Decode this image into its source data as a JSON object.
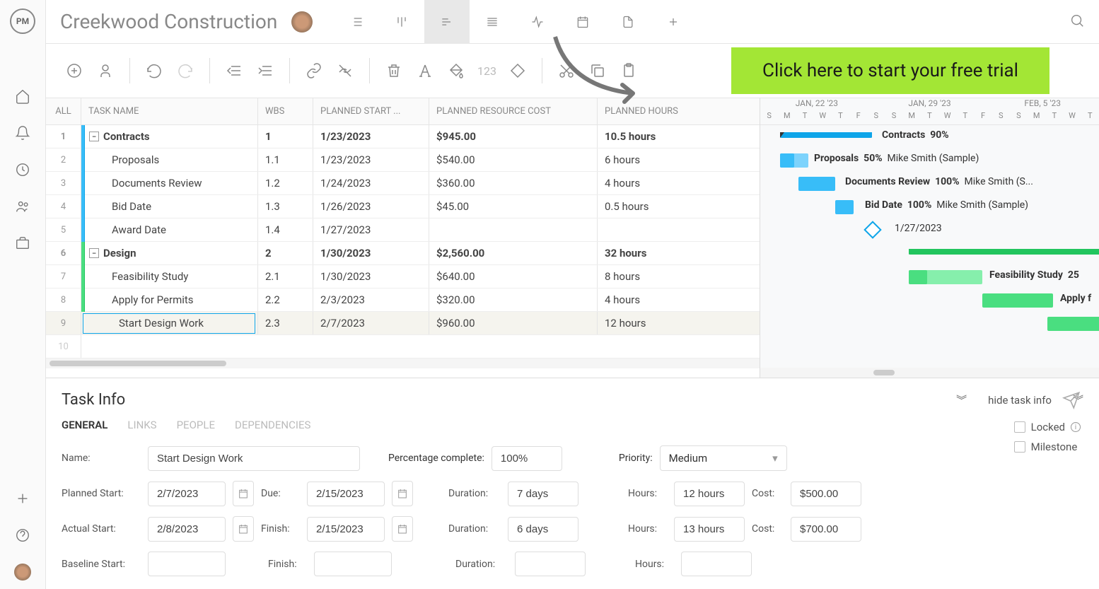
{
  "project": {
    "title": "Creekwood Construction"
  },
  "cta": {
    "text": "Click here to start your free trial"
  },
  "columns": {
    "all": "ALL",
    "task": "TASK NAME",
    "wbs": "WBS",
    "start": "PLANNED START ...",
    "cost": "PLANNED RESOURCE COST",
    "hours": "PLANNED HOURS"
  },
  "rows": [
    {
      "num": "1",
      "name": "Contracts",
      "wbs": "1",
      "start": "1/23/2023",
      "cost": "$945.00",
      "hours": "10.5 hours",
      "bold": true,
      "color": "blue",
      "expand": true
    },
    {
      "num": "2",
      "name": "Proposals",
      "wbs": "1.1",
      "start": "1/23/2023",
      "cost": "$540.00",
      "hours": "6 hours",
      "color": "blue",
      "indent": true
    },
    {
      "num": "3",
      "name": "Documents Review",
      "wbs": "1.2",
      "start": "1/24/2023",
      "cost": "$360.00",
      "hours": "4 hours",
      "color": "blue",
      "indent": true
    },
    {
      "num": "4",
      "name": "Bid Date",
      "wbs": "1.3",
      "start": "1/26/2023",
      "cost": "$45.00",
      "hours": "0.5 hours",
      "color": "blue",
      "indent": true
    },
    {
      "num": "5",
      "name": "Award Date",
      "wbs": "1.4",
      "start": "1/27/2023",
      "cost": "",
      "hours": "",
      "color": "blue",
      "indent": true
    },
    {
      "num": "6",
      "name": "Design",
      "wbs": "2",
      "start": "1/30/2023",
      "cost": "$2,560.00",
      "hours": "32 hours",
      "bold": true,
      "color": "green",
      "expand": true
    },
    {
      "num": "7",
      "name": "Feasibility Study",
      "wbs": "2.1",
      "start": "1/30/2023",
      "cost": "$640.00",
      "hours": "8 hours",
      "color": "green",
      "indent": true
    },
    {
      "num": "8",
      "name": "Apply for Permits",
      "wbs": "2.2",
      "start": "2/3/2023",
      "cost": "$320.00",
      "hours": "4 hours",
      "color": "green",
      "indent": true
    },
    {
      "num": "9",
      "name": "Start Design Work",
      "wbs": "2.3",
      "start": "2/7/2023",
      "cost": "$960.00",
      "hours": "12 hours",
      "color": "green",
      "indent": true,
      "selected": true
    }
  ],
  "gantt": {
    "weeks": [
      "JAN, 22 '23",
      "JAN, 29 '23",
      "FEB, 5 '23"
    ],
    "days": [
      "S",
      "M",
      "T",
      "W",
      "T",
      "F",
      "S",
      "S",
      "M",
      "T",
      "W",
      "T",
      "F",
      "S",
      "S",
      "M",
      "T",
      "W",
      "T"
    ],
    "bars": [
      {
        "label": "Contracts",
        "pct": "90%"
      },
      {
        "label": "Proposals",
        "pct": "50%",
        "assignee": "Mike Smith (Sample)"
      },
      {
        "label": "Documents Review",
        "pct": "100%",
        "assignee": "Mike Smith (S..."
      },
      {
        "label": "Bid Date",
        "pct": "100%",
        "assignee": "Mike Smith (Sample)"
      },
      {
        "milestone_date": "1/27/2023"
      },
      {
        "label": "Feasibility Study",
        "pct": "25"
      },
      {
        "label": "Apply f"
      }
    ]
  },
  "taskInfo": {
    "title": "Task Info",
    "hide": "hide task info",
    "tabs": [
      "GENERAL",
      "LINKS",
      "PEOPLE",
      "DEPENDENCIES"
    ],
    "labels": {
      "name": "Name:",
      "pct": "Percentage complete:",
      "priority": "Priority:",
      "plannedStart": "Planned Start:",
      "due": "Due:",
      "duration": "Duration:",
      "hours": "Hours:",
      "cost": "Cost:",
      "actualStart": "Actual Start:",
      "finish": "Finish:",
      "baselineStart": "Baseline Start:",
      "locked": "Locked",
      "milestone": "Milestone"
    },
    "values": {
      "name": "Start Design Work",
      "pct": "100%",
      "priority": "Medium",
      "plannedStart": "2/7/2023",
      "due": "2/15/2023",
      "duration1": "7 days",
      "hours1": "12 hours",
      "cost1": "$500.00",
      "actualStart": "2/8/2023",
      "finish": "2/15/2023",
      "duration2": "6 days",
      "hours2": "13 hours",
      "cost2": "$700.00"
    }
  },
  "toolbar": {
    "num": "123"
  }
}
